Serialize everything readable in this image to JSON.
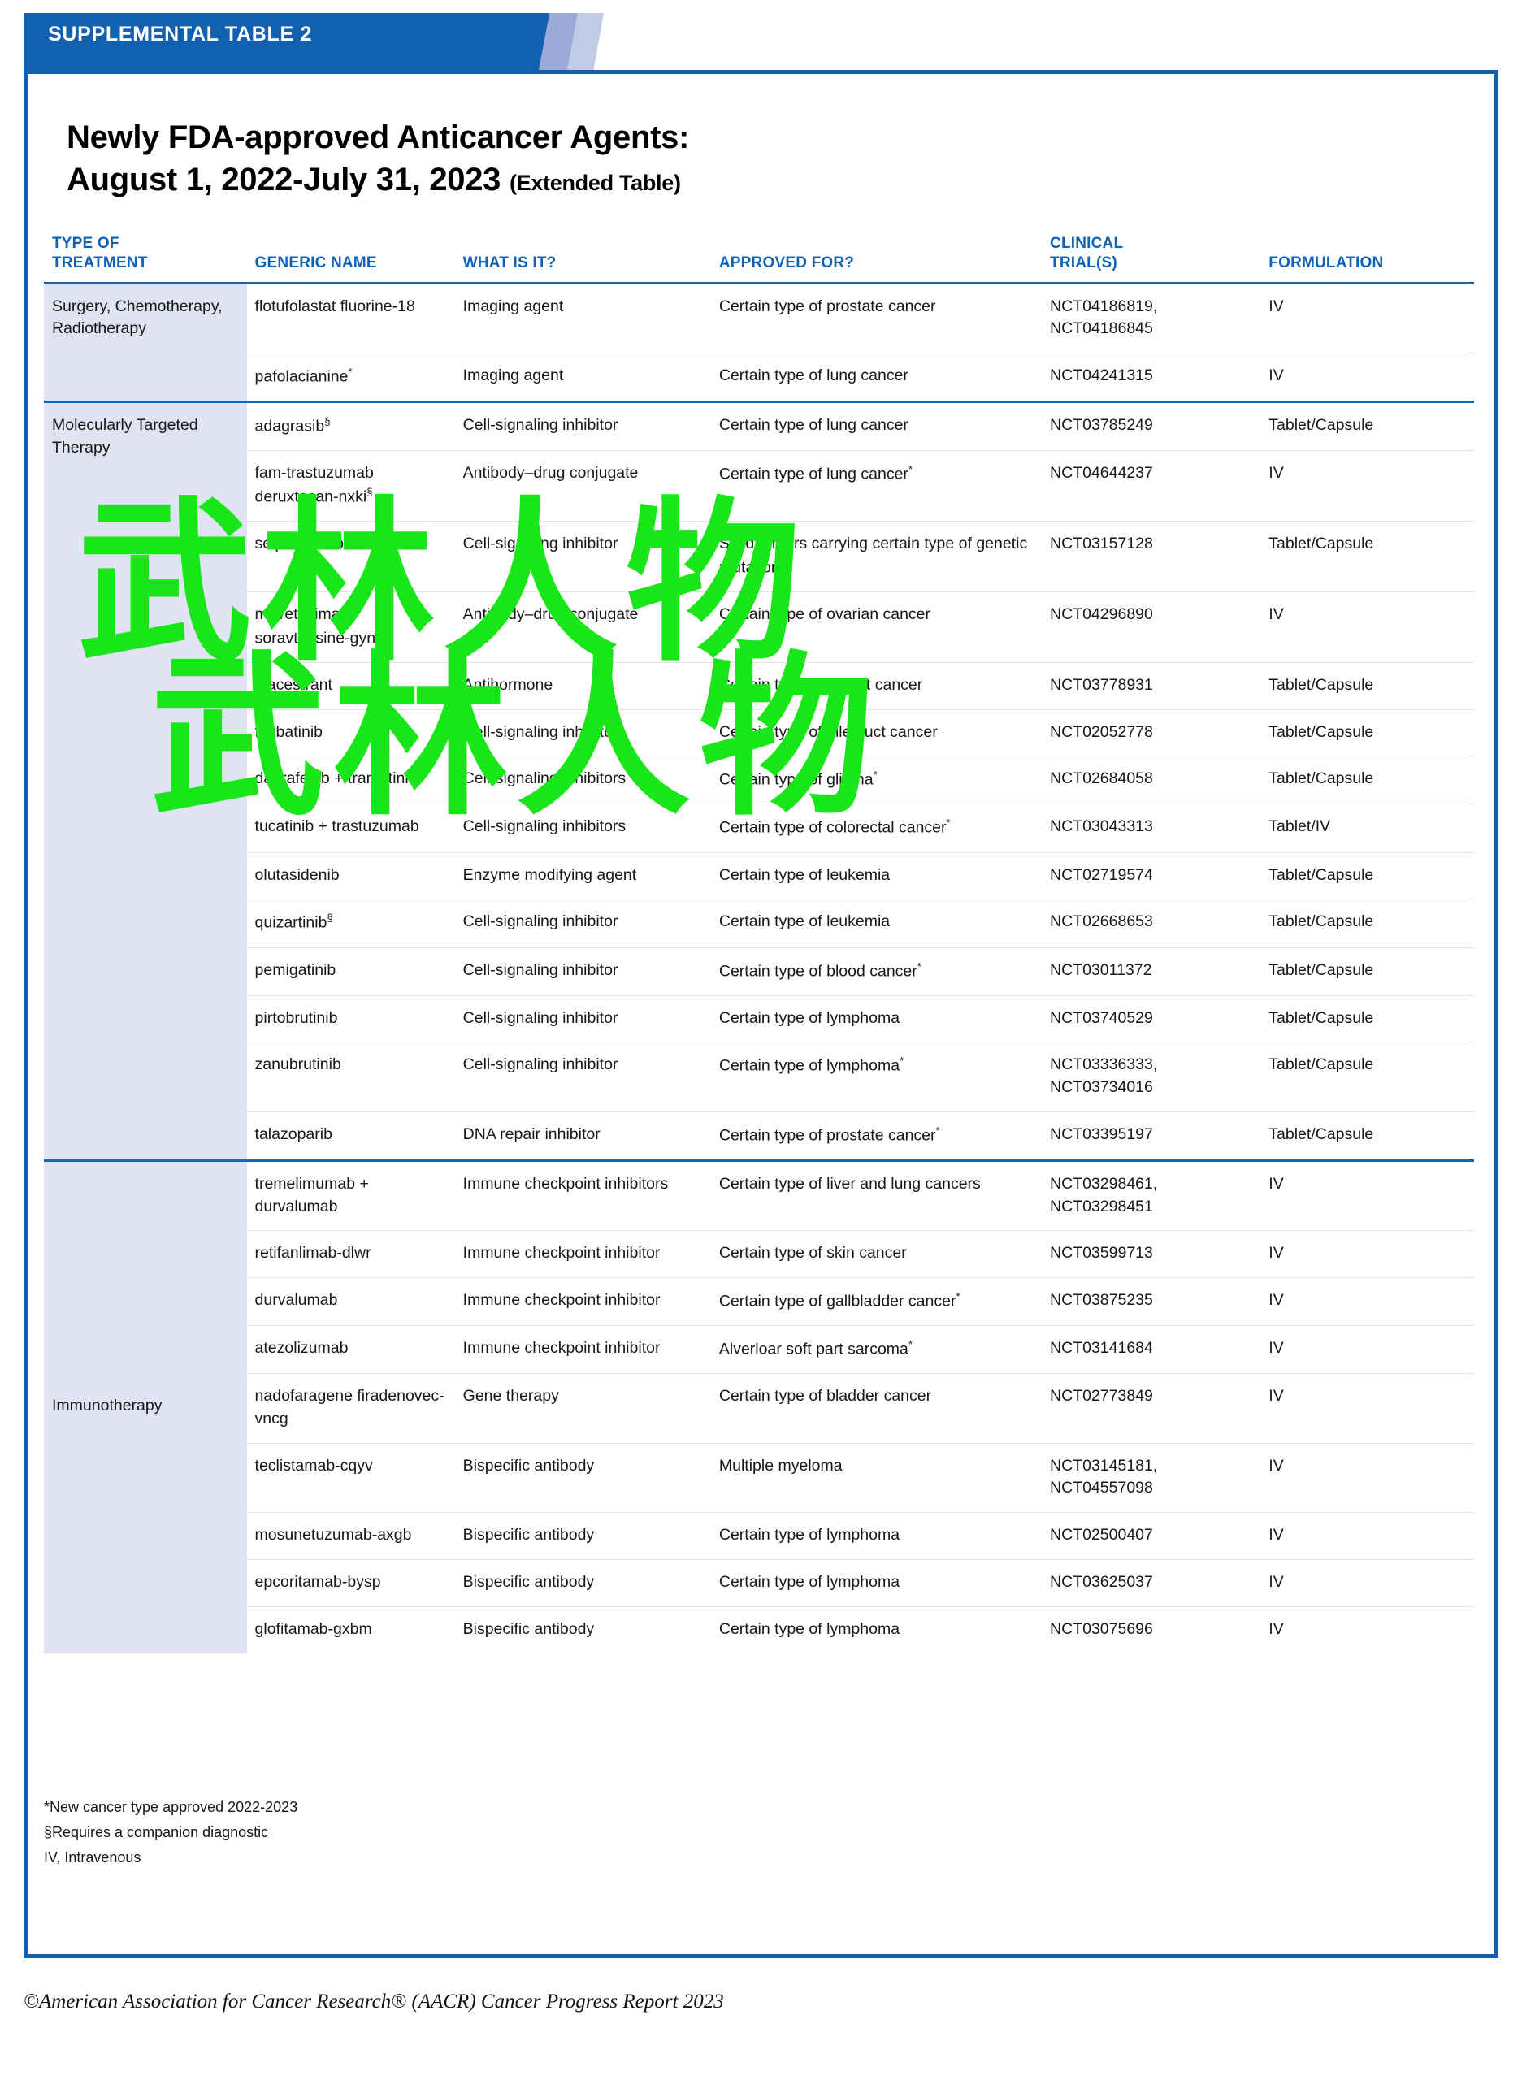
{
  "banner": {
    "label": "SUPPLEMENTAL TABLE 2"
  },
  "title": {
    "line1": "Newly FDA-approved Anticancer Agents:",
    "line2": "August 1, 2022-July 31, 2023",
    "suffix": "(Extended Table)"
  },
  "columns": [
    "TYPE OF TREATMENT",
    "GENERIC NAME",
    "WHAT IS IT?",
    "APPROVED FOR?",
    "CLINICAL TRIAL(S)",
    "FORMULATION"
  ],
  "columns_split": {
    "c0_l1": "TYPE OF",
    "c0_l2": "TREATMENT",
    "c1": "GENERIC NAME",
    "c2": "WHAT IS IT?",
    "c3": "APPROVED FOR?",
    "c4_l1": "CLINICAL",
    "c4_l2": "TRIAL(S)",
    "c5": "FORMULATION"
  },
  "groups": [
    {
      "category": "Surgery, Chemotherapy, Radiotherapy",
      "rows": [
        {
          "generic": "flotufolastat fluorine-18",
          "what": "Imaging agent",
          "approved": "Certain type of prostate cancer",
          "trials": "NCT04186819, NCT04186845",
          "formulation": "IV"
        },
        {
          "generic": "pafolacianine*",
          "what": "Imaging agent",
          "approved": "Certain type of lung cancer",
          "trials": "NCT04241315",
          "formulation": "IV"
        }
      ]
    },
    {
      "category": "Molecularly Targeted Therapy",
      "rows": [
        {
          "generic": "adagrasib§",
          "what": "Cell-signaling inhibitor",
          "approved": "Certain type of lung cancer",
          "trials": "NCT03785249",
          "formulation": "Tablet/Capsule"
        },
        {
          "generic": "fam-trastuzumab deruxtecan-nxki§",
          "what": "Antibody–drug conjugate",
          "approved": "Certain type of lung cancer*",
          "trials": "NCT04644237",
          "formulation": "IV"
        },
        {
          "generic": "selpercatinib",
          "what": "Cell-signaling inhibitor",
          "approved": "Solid tumors carrying certain type of genetic mutation*",
          "trials": "NCT03157128",
          "formulation": "Tablet/Capsule"
        },
        {
          "generic": "mirvetuximab soravtansine-gynx§",
          "what": "Antibody–drug conjugate",
          "approved": "Certain type of ovarian cancer",
          "trials": "NCT04296890",
          "formulation": "IV"
        },
        {
          "generic": "elacestrant",
          "what": "Antihormone",
          "approved": "Certain type of breast cancer",
          "trials": "NCT03778931",
          "formulation": "Tablet/Capsule"
        },
        {
          "generic": "futibatinib",
          "what": "Cell-signaling inhibitor",
          "approved": "Certain type of bile duct cancer",
          "trials": "NCT02052778",
          "formulation": "Tablet/Capsule"
        },
        {
          "generic": "dabrafenib + trametinib",
          "what": "Cell-signaling inhibitors",
          "approved": "Certain type of glioma*",
          "trials": "NCT02684058",
          "formulation": "Tablet/Capsule"
        },
        {
          "generic": "tucatinib + trastuzumab",
          "what": "Cell-signaling inhibitors",
          "approved": "Certain type of colorectal cancer*",
          "trials": "NCT03043313",
          "formulation": "Tablet/IV"
        },
        {
          "generic": "olutasidenib",
          "what": "Enzyme modifying agent",
          "approved": "Certain type of leukemia",
          "trials": "NCT02719574",
          "formulation": "Tablet/Capsule"
        },
        {
          "generic": "quizartinib§",
          "what": "Cell-signaling inhibitor",
          "approved": "Certain type of leukemia",
          "trials": "NCT02668653",
          "formulation": "Tablet/Capsule"
        },
        {
          "generic": "pemigatinib",
          "what": "Cell-signaling inhibitor",
          "approved": "Certain type of blood cancer*",
          "trials": "NCT03011372",
          "formulation": "Tablet/Capsule"
        },
        {
          "generic": "pirtobrutinib",
          "what": "Cell-signaling inhibitor",
          "approved": "Certain type of lymphoma",
          "trials": "NCT03740529",
          "formulation": "Tablet/Capsule"
        },
        {
          "generic": "zanubrutinib",
          "what": "Cell-signaling inhibitor",
          "approved": "Certain type of lymphoma*",
          "trials": "NCT03336333, NCT03734016",
          "formulation": "Tablet/Capsule"
        },
        {
          "generic": "talazoparib",
          "what": "DNA repair inhibitor",
          "approved": "Certain type of prostate cancer*",
          "trials": "NCT03395197",
          "formulation": "Tablet/Capsule"
        }
      ]
    },
    {
      "category": "Immunotherapy",
      "rows": [
        {
          "generic": "tremelimumab + durvalumab",
          "what": "Immune checkpoint inhibitors",
          "approved": "Certain type of liver and lung cancers",
          "trials": "NCT03298461, NCT03298451",
          "formulation": "IV"
        },
        {
          "generic": "retifanlimab-dlwr",
          "what": "Immune checkpoint inhibitor",
          "approved": "Certain type of skin cancer",
          "trials": "NCT03599713",
          "formulation": "IV"
        },
        {
          "generic": "durvalumab",
          "what": "Immune checkpoint inhibitor",
          "approved": "Certain type of gallbladder cancer*",
          "trials": "NCT03875235",
          "formulation": "IV"
        },
        {
          "generic": "atezolizumab",
          "what": "Immune checkpoint inhibitor",
          "approved": "Alverloar soft part sarcoma*",
          "trials": "NCT03141684",
          "formulation": "IV"
        },
        {
          "generic": "nadofaragene firadenovec-vncg",
          "what": "Gene therapy",
          "approved": "Certain type of bladder cancer",
          "trials": "NCT02773849",
          "formulation": "IV"
        },
        {
          "generic": "teclistamab-cqyv",
          "what": "Bispecific antibody",
          "approved": "Multiple myeloma",
          "trials": "NCT03145181, NCT04557098",
          "formulation": "IV"
        },
        {
          "generic": "mosunetuzumab-axgb",
          "what": "Bispecific antibody",
          "approved": "Certain type of lymphoma",
          "trials": "NCT02500407",
          "formulation": "IV"
        },
        {
          "generic": "epcoritamab-bysp",
          "what": "Bispecific antibody",
          "approved": "Certain type of lymphoma",
          "trials": "NCT03625037",
          "formulation": "IV"
        },
        {
          "generic": "glofitamab-gxbm",
          "what": "Bispecific antibody",
          "approved": "Certain type of lymphoma",
          "trials": "NCT03075696",
          "formulation": "IV"
        }
      ]
    }
  ],
  "footnotes": [
    "*New cancer type approved 2022-2023",
    "§Requires a companion diagnostic",
    "IV, Intravenous"
  ],
  "copyright": "©American Association for Cancer Research® (AACR) Cancer Progress Report 2023",
  "watermark": {
    "line1": "武林人物",
    "line2": "武林人物",
    "color": "#19e619"
  },
  "colors": {
    "brand_blue": "#1161b0",
    "header_text_blue": "#1161b0",
    "category_bg": "#dfe3f2",
    "rule": "#e3e3e3",
    "group_rule": "#1b64ae"
  }
}
